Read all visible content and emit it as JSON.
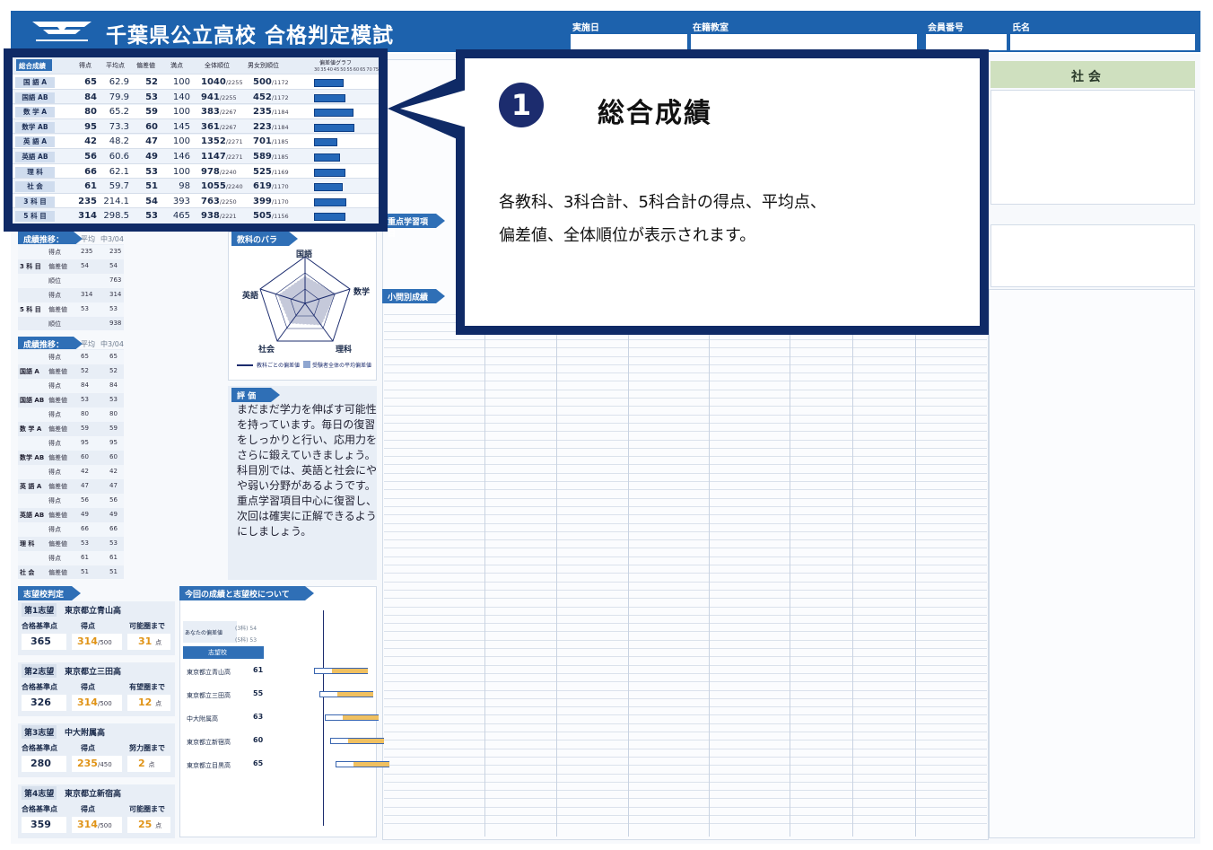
{
  "header": {
    "title": "千葉県公立高校 合格判定模試",
    "fields": [
      "実施日",
      "在籍教室",
      "会員番号",
      "氏名"
    ],
    "social_heading": "社 会"
  },
  "summary": {
    "caption": "総合成績",
    "columns": [
      "得点",
      "平均点",
      "偏差値",
      "満点",
      "全体順位",
      "男女別順位",
      "偏差値グラフ"
    ],
    "graph_ticks": [
      "30",
      "35",
      "40",
      "45",
      "50",
      "55",
      "60",
      "65",
      "70",
      "75"
    ],
    "rows": [
      {
        "subject": "国 語 A",
        "score": "65",
        "avg": "62.9",
        "dev": "52",
        "full": "100",
        "rank": "1040",
        "rank_total": "/2255",
        "gender_rank": "500",
        "gender_total": "/1172",
        "dev_value": 52
      },
      {
        "subject": "国語 AB",
        "score": "84",
        "avg": "79.9",
        "dev": "53",
        "full": "140",
        "rank": "941",
        "rank_total": "/2255",
        "gender_rank": "452",
        "gender_total": "/1172",
        "dev_value": 53
      },
      {
        "subject": "数 学 A",
        "score": "80",
        "avg": "65.2",
        "dev": "59",
        "full": "100",
        "rank": "383",
        "rank_total": "/2267",
        "gender_rank": "235",
        "gender_total": "/1184",
        "dev_value": 59
      },
      {
        "subject": "数学 AB",
        "score": "95",
        "avg": "73.3",
        "dev": "60",
        "full": "145",
        "rank": "361",
        "rank_total": "/2267",
        "gender_rank": "223",
        "gender_total": "/1184",
        "dev_value": 60
      },
      {
        "subject": "英 語 A",
        "score": "42",
        "avg": "48.2",
        "dev": "47",
        "full": "100",
        "rank": "1352",
        "rank_total": "/2271",
        "gender_rank": "701",
        "gender_total": "/1185",
        "dev_value": 47
      },
      {
        "subject": "英語 AB",
        "score": "56",
        "avg": "60.6",
        "dev": "49",
        "full": "146",
        "rank": "1147",
        "rank_total": "/2271",
        "gender_rank": "589",
        "gender_total": "/1185",
        "dev_value": 49
      },
      {
        "subject": "理 科",
        "score": "66",
        "avg": "62.1",
        "dev": "53",
        "full": "100",
        "rank": "978",
        "rank_total": "/2240",
        "gender_rank": "525",
        "gender_total": "/1169",
        "dev_value": 53
      },
      {
        "subject": "社 会",
        "score": "61",
        "avg": "59.7",
        "dev": "51",
        "full": "98",
        "rank": "1055",
        "rank_total": "/2240",
        "gender_rank": "619",
        "gender_total": "/1170",
        "dev_value": 51
      },
      {
        "subject": "3 科 目",
        "score": "235",
        "avg": "214.1",
        "dev": "54",
        "full": "393",
        "rank": "763",
        "rank_total": "/2250",
        "gender_rank": "399",
        "gender_total": "/1170",
        "dev_value": 54
      },
      {
        "subject": "5 科 目",
        "score": "314",
        "avg": "298.5",
        "dev": "53",
        "full": "465",
        "rank": "938",
        "rank_total": "/2221",
        "gender_rank": "505",
        "gender_total": "/1156",
        "dev_value": 53
      }
    ]
  },
  "callout": {
    "number": "1",
    "title": "総合成績",
    "line1": "各教科、3科合計、5科合計の得点、平均点、",
    "line2": "偏差値、全体順位が表示されます。"
  },
  "trend_total": {
    "heading": "成績推移：総合",
    "col1": "平均",
    "col2": "中3/04",
    "rows": [
      {
        "group": "",
        "label": "得点",
        "a": "235",
        "b": "235"
      },
      {
        "group": "3 科 目",
        "label": "偏差値",
        "a": "54",
        "b": "54"
      },
      {
        "group": "",
        "label": "順位",
        "a": "",
        "b": "763"
      },
      {
        "group": "",
        "label": "得点",
        "a": "314",
        "b": "314"
      },
      {
        "group": "5 科 目",
        "label": "偏差値",
        "a": "53",
        "b": "53"
      },
      {
        "group": "",
        "label": "順位",
        "a": "",
        "b": "938"
      }
    ]
  },
  "trend_subject": {
    "heading": "成績推移：科目",
    "col1": "平均",
    "col2": "中3/04",
    "rows": [
      {
        "group": "",
        "label": "得点",
        "a": "65",
        "b": "65"
      },
      {
        "group": "国語 A",
        "label": "偏差値",
        "a": "52",
        "b": "52"
      },
      {
        "group": "",
        "label": "得点",
        "a": "84",
        "b": "84"
      },
      {
        "group": "国語 AB",
        "label": "偏差値",
        "a": "53",
        "b": "53"
      },
      {
        "group": "",
        "label": "得点",
        "a": "80",
        "b": "80"
      },
      {
        "group": "数 学 A",
        "label": "偏差値",
        "a": "59",
        "b": "59"
      },
      {
        "group": "",
        "label": "得点",
        "a": "95",
        "b": "95"
      },
      {
        "group": "数学 AB",
        "label": "偏差値",
        "a": "60",
        "b": "60"
      },
      {
        "group": "",
        "label": "得点",
        "a": "42",
        "b": "42"
      },
      {
        "group": "英 語 A",
        "label": "偏差値",
        "a": "47",
        "b": "47"
      },
      {
        "group": "",
        "label": "得点",
        "a": "56",
        "b": "56"
      },
      {
        "group": "英語 AB",
        "label": "偏差値",
        "a": "49",
        "b": "49"
      },
      {
        "group": "",
        "label": "得点",
        "a": "66",
        "b": "66"
      },
      {
        "group": "理 科",
        "label": "偏差値",
        "a": "53",
        "b": "53"
      },
      {
        "group": "",
        "label": "得点",
        "a": "61",
        "b": "61"
      },
      {
        "group": "社 会",
        "label": "偏差値",
        "a": "51",
        "b": "51"
      }
    ]
  },
  "balance": {
    "heading": "教科のバランス",
    "labels": {
      "kokugo": "国語",
      "sugaku": "数学",
      "rika": "理科",
      "shakai": "社会",
      "eigo": "英語"
    },
    "legend1": "教科ごとの偏差値",
    "legend2": "受験者全体の平均偏差値"
  },
  "evaluation": {
    "heading": "評 価",
    "text": "まだまだ学力を伸ばす可能性を持っています。毎日の復習をしっかりと行い、応用力をさらに鍛えていきましょう。科目別では、英語と社会にやや弱い分野があるようです。重点学習項目中心に復習し、次回は確実に正解できるようにしましょう。"
  },
  "choices": {
    "heading": "志望校判定",
    "items": [
      {
        "tag": "第1志望",
        "school": "東京都立青山高",
        "base_label": "合格基準点",
        "score_label": "得点",
        "diff_label": "可能圏まで",
        "base": "365",
        "score": "314",
        "score_unit": "/500",
        "diff": "31",
        "diff_unit": "点"
      },
      {
        "tag": "第2志望",
        "school": "東京都立三田高",
        "base_label": "合格基準点",
        "score_label": "得点",
        "diff_label": "有望圏まで",
        "base": "326",
        "score": "314",
        "score_unit": "/500",
        "diff": "12",
        "diff_unit": "点"
      },
      {
        "tag": "第3志望",
        "school": "中大附属高",
        "base_label": "合格基準点",
        "score_label": "得点",
        "diff_label": "努力圏まで",
        "base": "280",
        "score": "235",
        "score_unit": "/450",
        "diff": "2",
        "diff_unit": "点"
      },
      {
        "tag": "第4志望",
        "school": "東京都立新宿高",
        "base_label": "合格基準点",
        "score_label": "得点",
        "diff_label": "可能圏まで",
        "base": "359",
        "score": "314",
        "score_unit": "/500",
        "diff": "25",
        "diff_unit": "点"
      }
    ]
  },
  "current": {
    "heading": "今回の成績と志望校について",
    "mine_label": "あなたの偏差値",
    "s3": "(3科) 54",
    "s5": "(5科) 53",
    "choice_col": "志望校",
    "schools": [
      {
        "name": "東京都立青山高",
        "dev": "61"
      },
      {
        "name": "東京都立三田高",
        "dev": "55"
      },
      {
        "name": "中大附属高",
        "dev": "63"
      },
      {
        "name": "東京都立新宿高",
        "dev": "60"
      },
      {
        "name": "東京都立目黒高",
        "dev": "65"
      }
    ]
  },
  "center": {
    "heading1": "重点学習項目",
    "heading2": "小問別成績"
  }
}
